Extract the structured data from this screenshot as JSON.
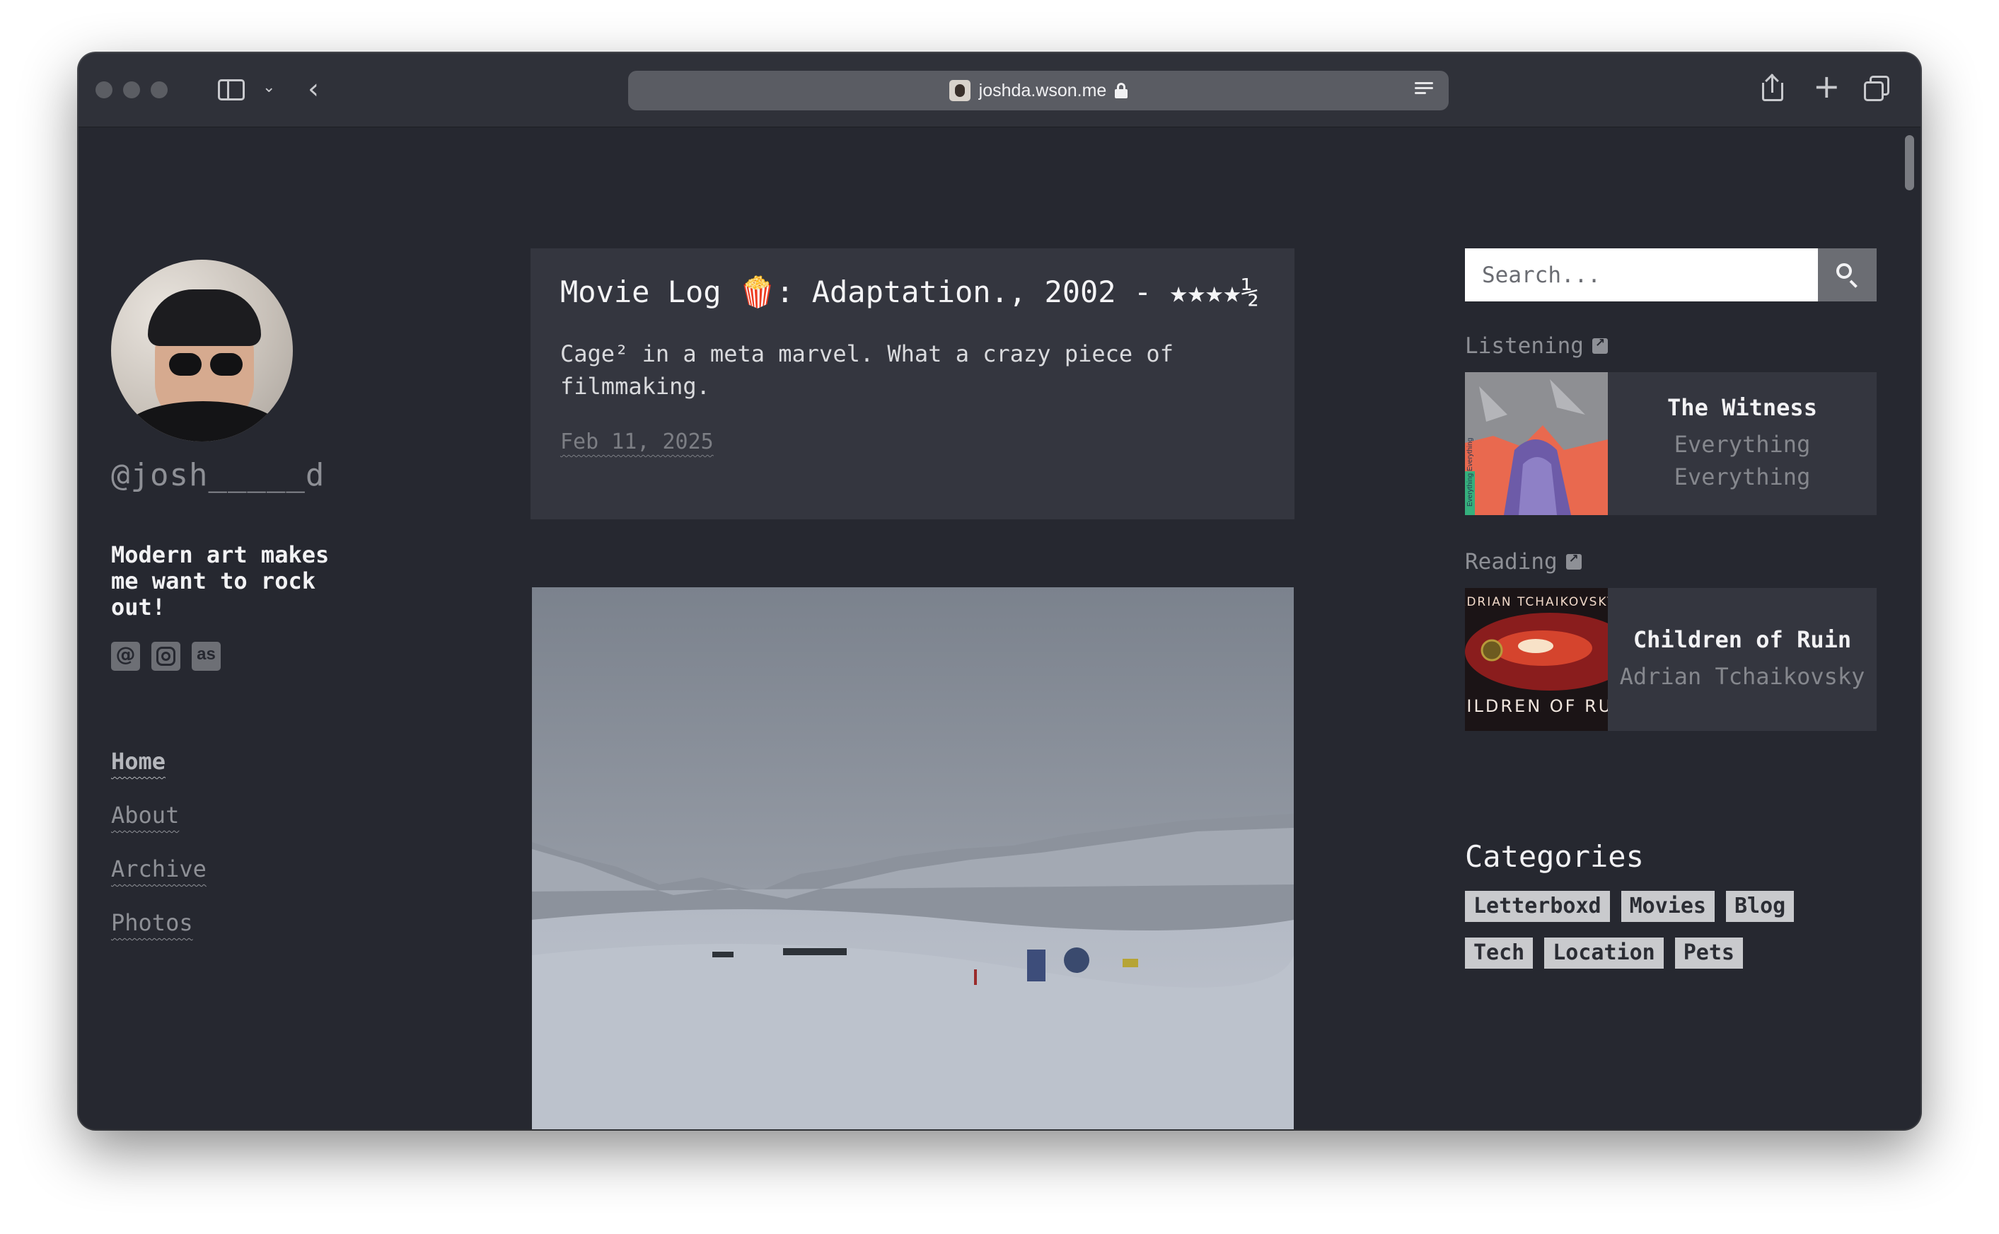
{
  "browser": {
    "url": "joshda.wson.me"
  },
  "profile": {
    "handle": "@josh_____d",
    "bio": "Modern art makes me want to rock out!",
    "socials": [
      "threads-icon",
      "instagram-icon",
      "lastfm-icon"
    ]
  },
  "nav": {
    "items": [
      {
        "label": "Home",
        "active": true
      },
      {
        "label": "About"
      },
      {
        "label": "Archive"
      },
      {
        "label": "Photos"
      }
    ]
  },
  "post": {
    "title": "Movie Log 🍿: Adaptation., 2002 - ★★★★½",
    "body": "Cage² in a meta marvel. What a crazy piece of filmmaking.",
    "date": "Feb 11, 2025"
  },
  "sidebar": {
    "search_placeholder": "Search...",
    "listening": {
      "label": "Listening",
      "title": "The Witness",
      "subtitle": "Everything Everything",
      "cover_text": "Everything Everything"
    },
    "reading": {
      "label": "Reading",
      "title": "Children of Ruin",
      "author": "Adrian Tchaikovsky",
      "cover_author": "ADRIAN TCHAIKOVSKY",
      "cover_title": "CHILDREN OF RUIN"
    },
    "categories_title": "Categories",
    "categories": [
      "Letterboxd",
      "Movies",
      "Blog",
      "Tech",
      "Location",
      "Pets"
    ]
  },
  "colors": {
    "page_bg": "#262830",
    "card_bg": "#34363f",
    "muted_text": "#8e9096",
    "tag_bg": "#c9cacd"
  }
}
